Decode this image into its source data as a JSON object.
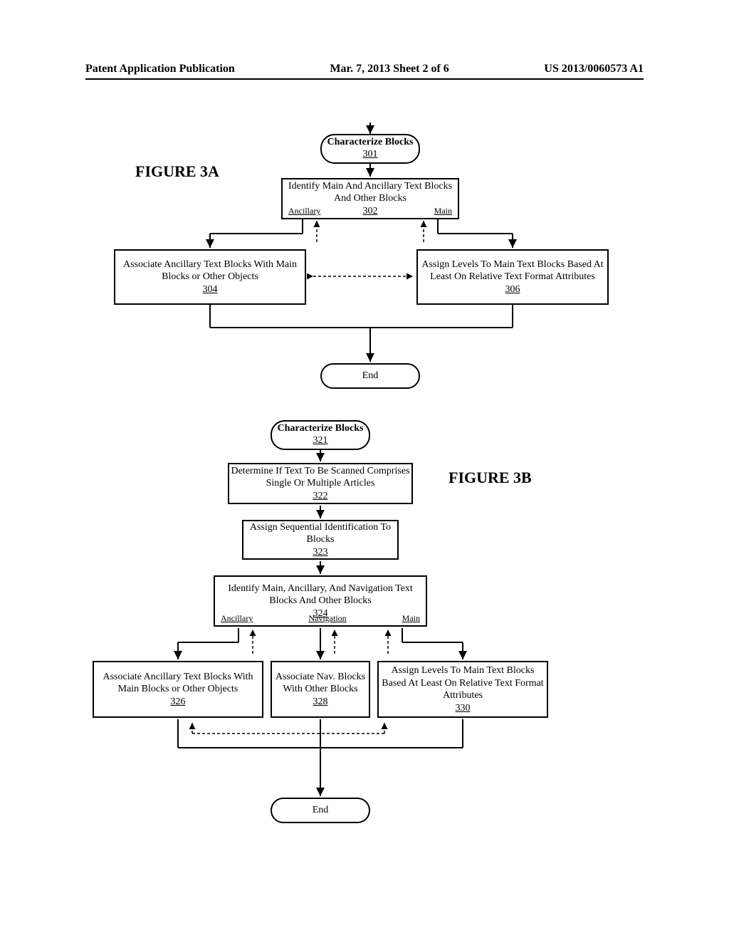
{
  "header": {
    "left": "Patent Application Publication",
    "center": "Mar. 7, 2013  Sheet 2 of 6",
    "right": "US 2013/0060573 A1"
  },
  "figA": {
    "label": "FIGURE 3A",
    "start": {
      "title": "Characterize Blocks",
      "num": "301"
    },
    "identify": {
      "text": "Identify Main And Ancillary Text Blocks And Other Blocks",
      "num": "302"
    },
    "branchLeft": "Ancillary",
    "branchRight": "Main",
    "left": {
      "text": "Associate Ancillary Text Blocks With Main Blocks or Other Objects",
      "num": "304"
    },
    "right": {
      "text": "Assign Levels To Main Text Blocks Based At Least On Relative Text Format Attributes",
      "num": "306"
    },
    "end": "End"
  },
  "figB": {
    "label": "FIGURE 3B",
    "start": {
      "title": "Characterize Blocks",
      "num": "321"
    },
    "step1": {
      "text": "Determine If Text To Be Scanned Comprises Single Or Multiple Articles",
      "num": "322"
    },
    "step2": {
      "text": "Assign Sequential Identification To Blocks",
      "num": "323"
    },
    "identify": {
      "text": "Identify Main, Ancillary, And Navigation Text Blocks And Other Blocks",
      "num": "324"
    },
    "branchLeft": "Ancillary",
    "branchMid": "Navigation",
    "branchRight": "Main",
    "left": {
      "text": "Associate Ancillary Text Blocks With Main Blocks or Other Objects",
      "num": "326"
    },
    "mid": {
      "text": "Associate Nav. Blocks With Other Blocks",
      "num": "328"
    },
    "right": {
      "text": "Assign Levels To Main Text Blocks Based At Least On Relative Text Format Attributes",
      "num": "330"
    },
    "end": "End"
  }
}
